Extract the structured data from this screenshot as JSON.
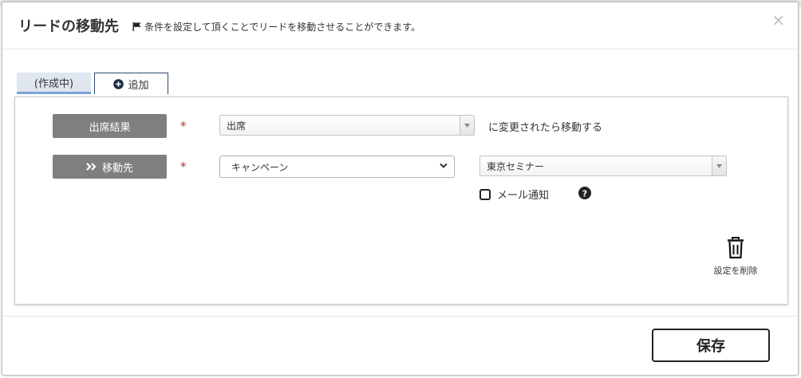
{
  "modal": {
    "title": "リードの移動先",
    "subtitle": "条件を設定して頂くことでリードを移動させることができます。",
    "close_symbol": "×"
  },
  "tabs": [
    {
      "label": "(作成中)",
      "active": true
    },
    {
      "label": "追加",
      "active": false
    }
  ],
  "rows": {
    "condition": {
      "label": "出席結果",
      "required_mark": "*",
      "select_value": "出席",
      "suffix": "に変更されたら移動する"
    },
    "destination": {
      "label": "移動先",
      "label_icon": "double-chevron-right-icon",
      "required_mark": "*",
      "type_select_value": "キャンペーン",
      "target_select_value": "東京セミナー",
      "mail_notify_label": "メール通知",
      "mail_notify_checked": false
    }
  },
  "delete": {
    "label": "設定を削除"
  },
  "footer": {
    "save_label": "保存"
  },
  "colors": {
    "label_bg": "#7f7f7f",
    "tab_active_bg": "#dfe6ef",
    "tab_active_border": "#7da4d6",
    "tab_add_border": "#2b4a70",
    "required": "#aa3333"
  }
}
